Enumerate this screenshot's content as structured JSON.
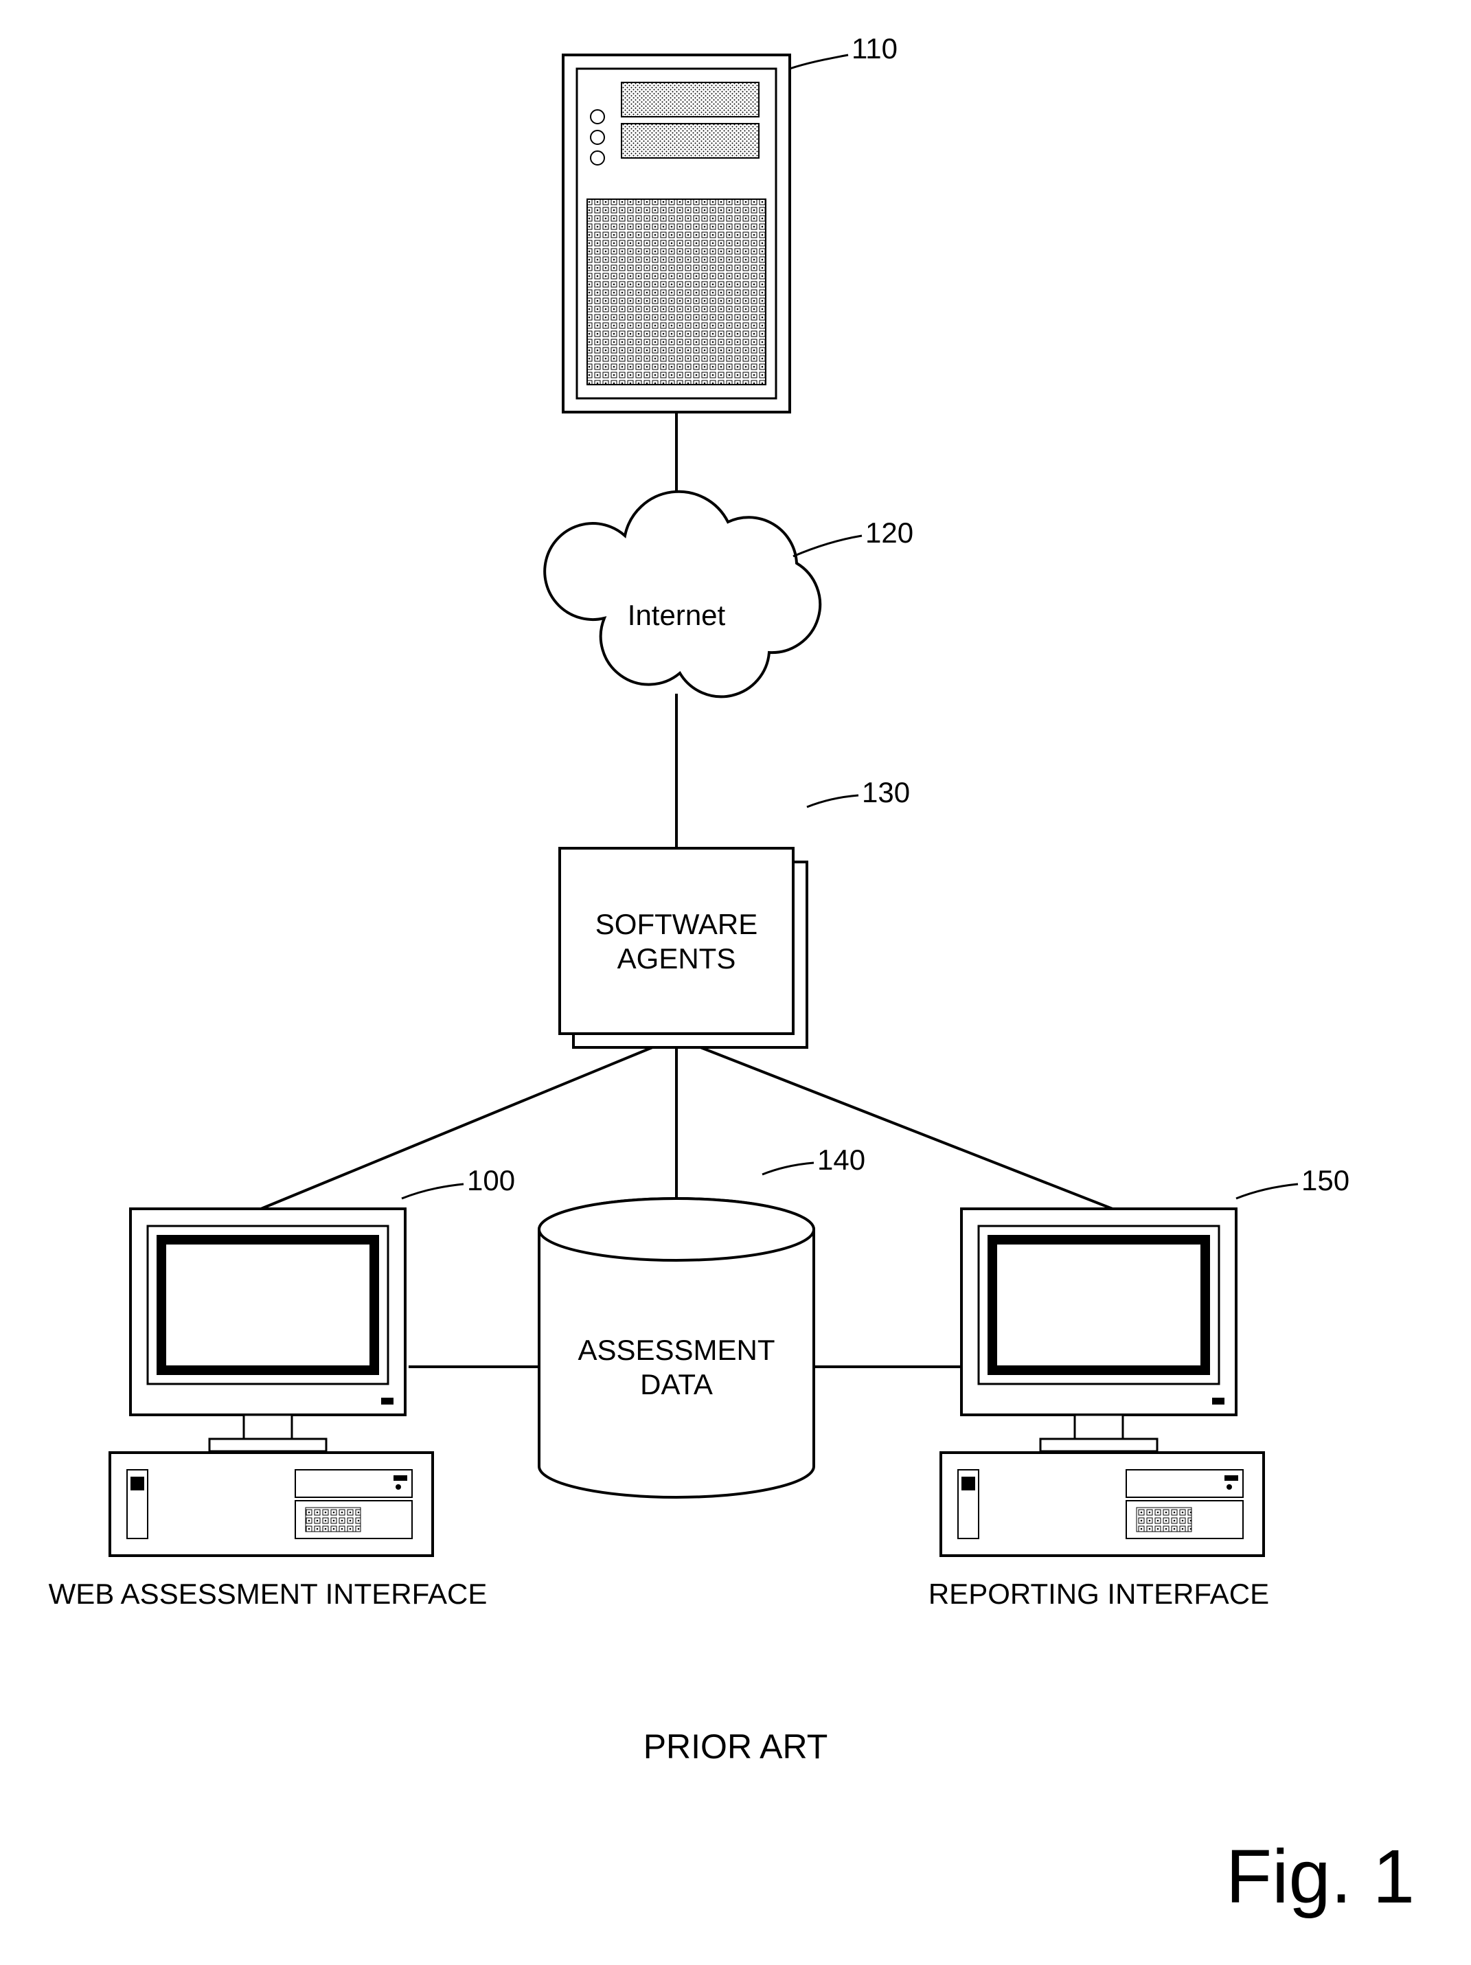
{
  "chart_data": {
    "type": "diagram",
    "title": "PRIOR ART",
    "figure_label": "Fig. 1",
    "nodes": [
      {
        "id": "110",
        "label": "",
        "kind": "mainframe",
        "ref": "110"
      },
      {
        "id": "120",
        "label": "Internet",
        "kind": "cloud",
        "ref": "120"
      },
      {
        "id": "130",
        "label": "SOFTWARE AGENTS",
        "kind": "stacked-box",
        "ref": "130"
      },
      {
        "id": "140",
        "label": "ASSESSMENT DATA",
        "kind": "cylinder",
        "ref": "140"
      },
      {
        "id": "100",
        "label": "WEB ASSESSMENT INTERFACE",
        "kind": "workstation",
        "ref": "100"
      },
      {
        "id": "150",
        "label": "REPORTING INTERFACE",
        "kind": "workstation",
        "ref": "150"
      }
    ],
    "edges": [
      [
        "110",
        "120"
      ],
      [
        "120",
        "130"
      ],
      [
        "130",
        "100"
      ],
      [
        "130",
        "140"
      ],
      [
        "130",
        "150"
      ],
      [
        "100",
        "140"
      ],
      [
        "140",
        "150"
      ]
    ]
  },
  "refs": {
    "server": "110",
    "cloud": "120",
    "agents": "130",
    "data": "140",
    "web_if": "100",
    "report_if": "150"
  },
  "labels": {
    "cloud": "Internet",
    "agents_line1": "SOFTWARE",
    "agents_line2": "AGENTS",
    "data_line1": "ASSESSMENT",
    "data_line2": "DATA",
    "web_if": "WEB ASSESSMENT INTERFACE",
    "report_if": "REPORTING INTERFACE",
    "prior_art": "PRIOR ART",
    "figure": "Fig. 1"
  }
}
